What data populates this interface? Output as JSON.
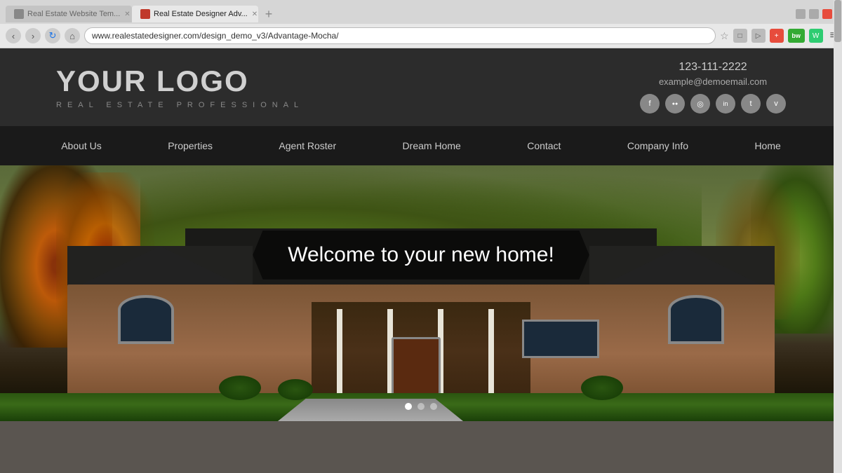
{
  "browser": {
    "tabs": [
      {
        "id": "tab1",
        "label": "Real Estate Website Tem...",
        "active": false
      },
      {
        "id": "tab2",
        "label": "Real Estate Designer Adv...",
        "active": true
      }
    ],
    "address_bar": "www.realestatedesigner.com/design_demo_v3/Advantage-Mocha/"
  },
  "header": {
    "logo": "YOUR LOGO",
    "subtitle": "REAL ESTATE PROFESSIONAL",
    "phone": "123-111-2222",
    "email": "example@demoemail.com",
    "social": [
      {
        "name": "facebook",
        "symbol": "f"
      },
      {
        "name": "flickr",
        "symbol": "●●"
      },
      {
        "name": "instagram",
        "symbol": "◎"
      },
      {
        "name": "linkedin",
        "symbol": "in"
      },
      {
        "name": "twitter",
        "symbol": "t"
      },
      {
        "name": "vimeo",
        "symbol": "v"
      }
    ]
  },
  "nav": {
    "items": [
      {
        "label": "About Us"
      },
      {
        "label": "Properties"
      },
      {
        "label": "Agent Roster"
      },
      {
        "label": "Dream Home"
      },
      {
        "label": "Contact"
      },
      {
        "label": "Company Info"
      },
      {
        "label": "Home"
      }
    ]
  },
  "hero": {
    "welcome_text": "Welcome to your new home!",
    "dots": [
      {
        "active": true
      },
      {
        "active": false
      },
      {
        "active": false
      }
    ]
  }
}
